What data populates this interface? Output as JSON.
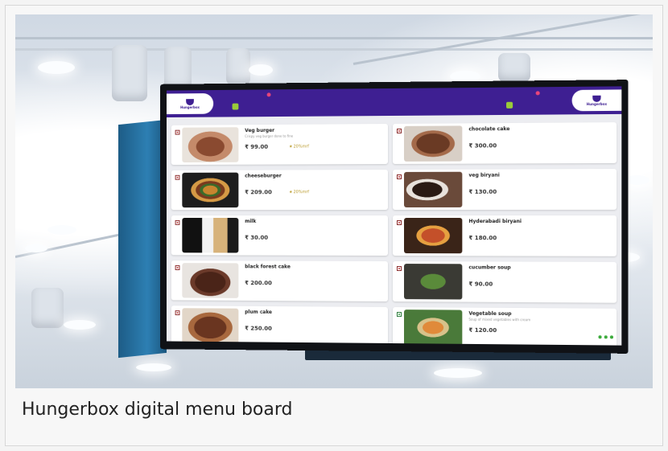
{
  "caption": "Hungerbox digital menu board",
  "brand": {
    "logo_text": "Hungerbox",
    "primary_color": "#3e1f92",
    "accent_color": "#3aaa3a"
  },
  "menu": {
    "left": [
      {
        "name": "Veg burger",
        "desc": "Crispy veg burger done to fine",
        "price": "₹ 99.00",
        "tag": "20%mrf",
        "veg": false
      },
      {
        "name": "cheeseburger",
        "desc": "",
        "price": "₹ 209.00",
        "tag": "20%mrf",
        "veg": false
      },
      {
        "name": "milk",
        "desc": "",
        "price": "₹ 30.00",
        "tag": "",
        "veg": false
      },
      {
        "name": "black forest cake",
        "desc": "",
        "price": "₹ 200.00",
        "tag": "",
        "veg": false
      },
      {
        "name": "plum cake",
        "desc": "",
        "price": "₹ 250.00",
        "tag": "",
        "veg": false
      }
    ],
    "right": [
      {
        "name": "chocolate cake",
        "desc": "",
        "price": "₹ 300.00",
        "tag": "",
        "veg": false
      },
      {
        "name": "veg biryani",
        "desc": "",
        "price": "₹ 130.00",
        "tag": "",
        "veg": false
      },
      {
        "name": "Hyderabadi biryani",
        "desc": "",
        "price": "₹ 180.00",
        "tag": "",
        "veg": false
      },
      {
        "name": "cucumber soup",
        "desc": "",
        "price": "₹ 90.00",
        "tag": "",
        "veg": false
      },
      {
        "name": "Vegetable soup",
        "desc": "Soup of mixed vegetables with cream",
        "price": "₹ 120.00",
        "tag": "",
        "veg": true
      }
    ]
  }
}
